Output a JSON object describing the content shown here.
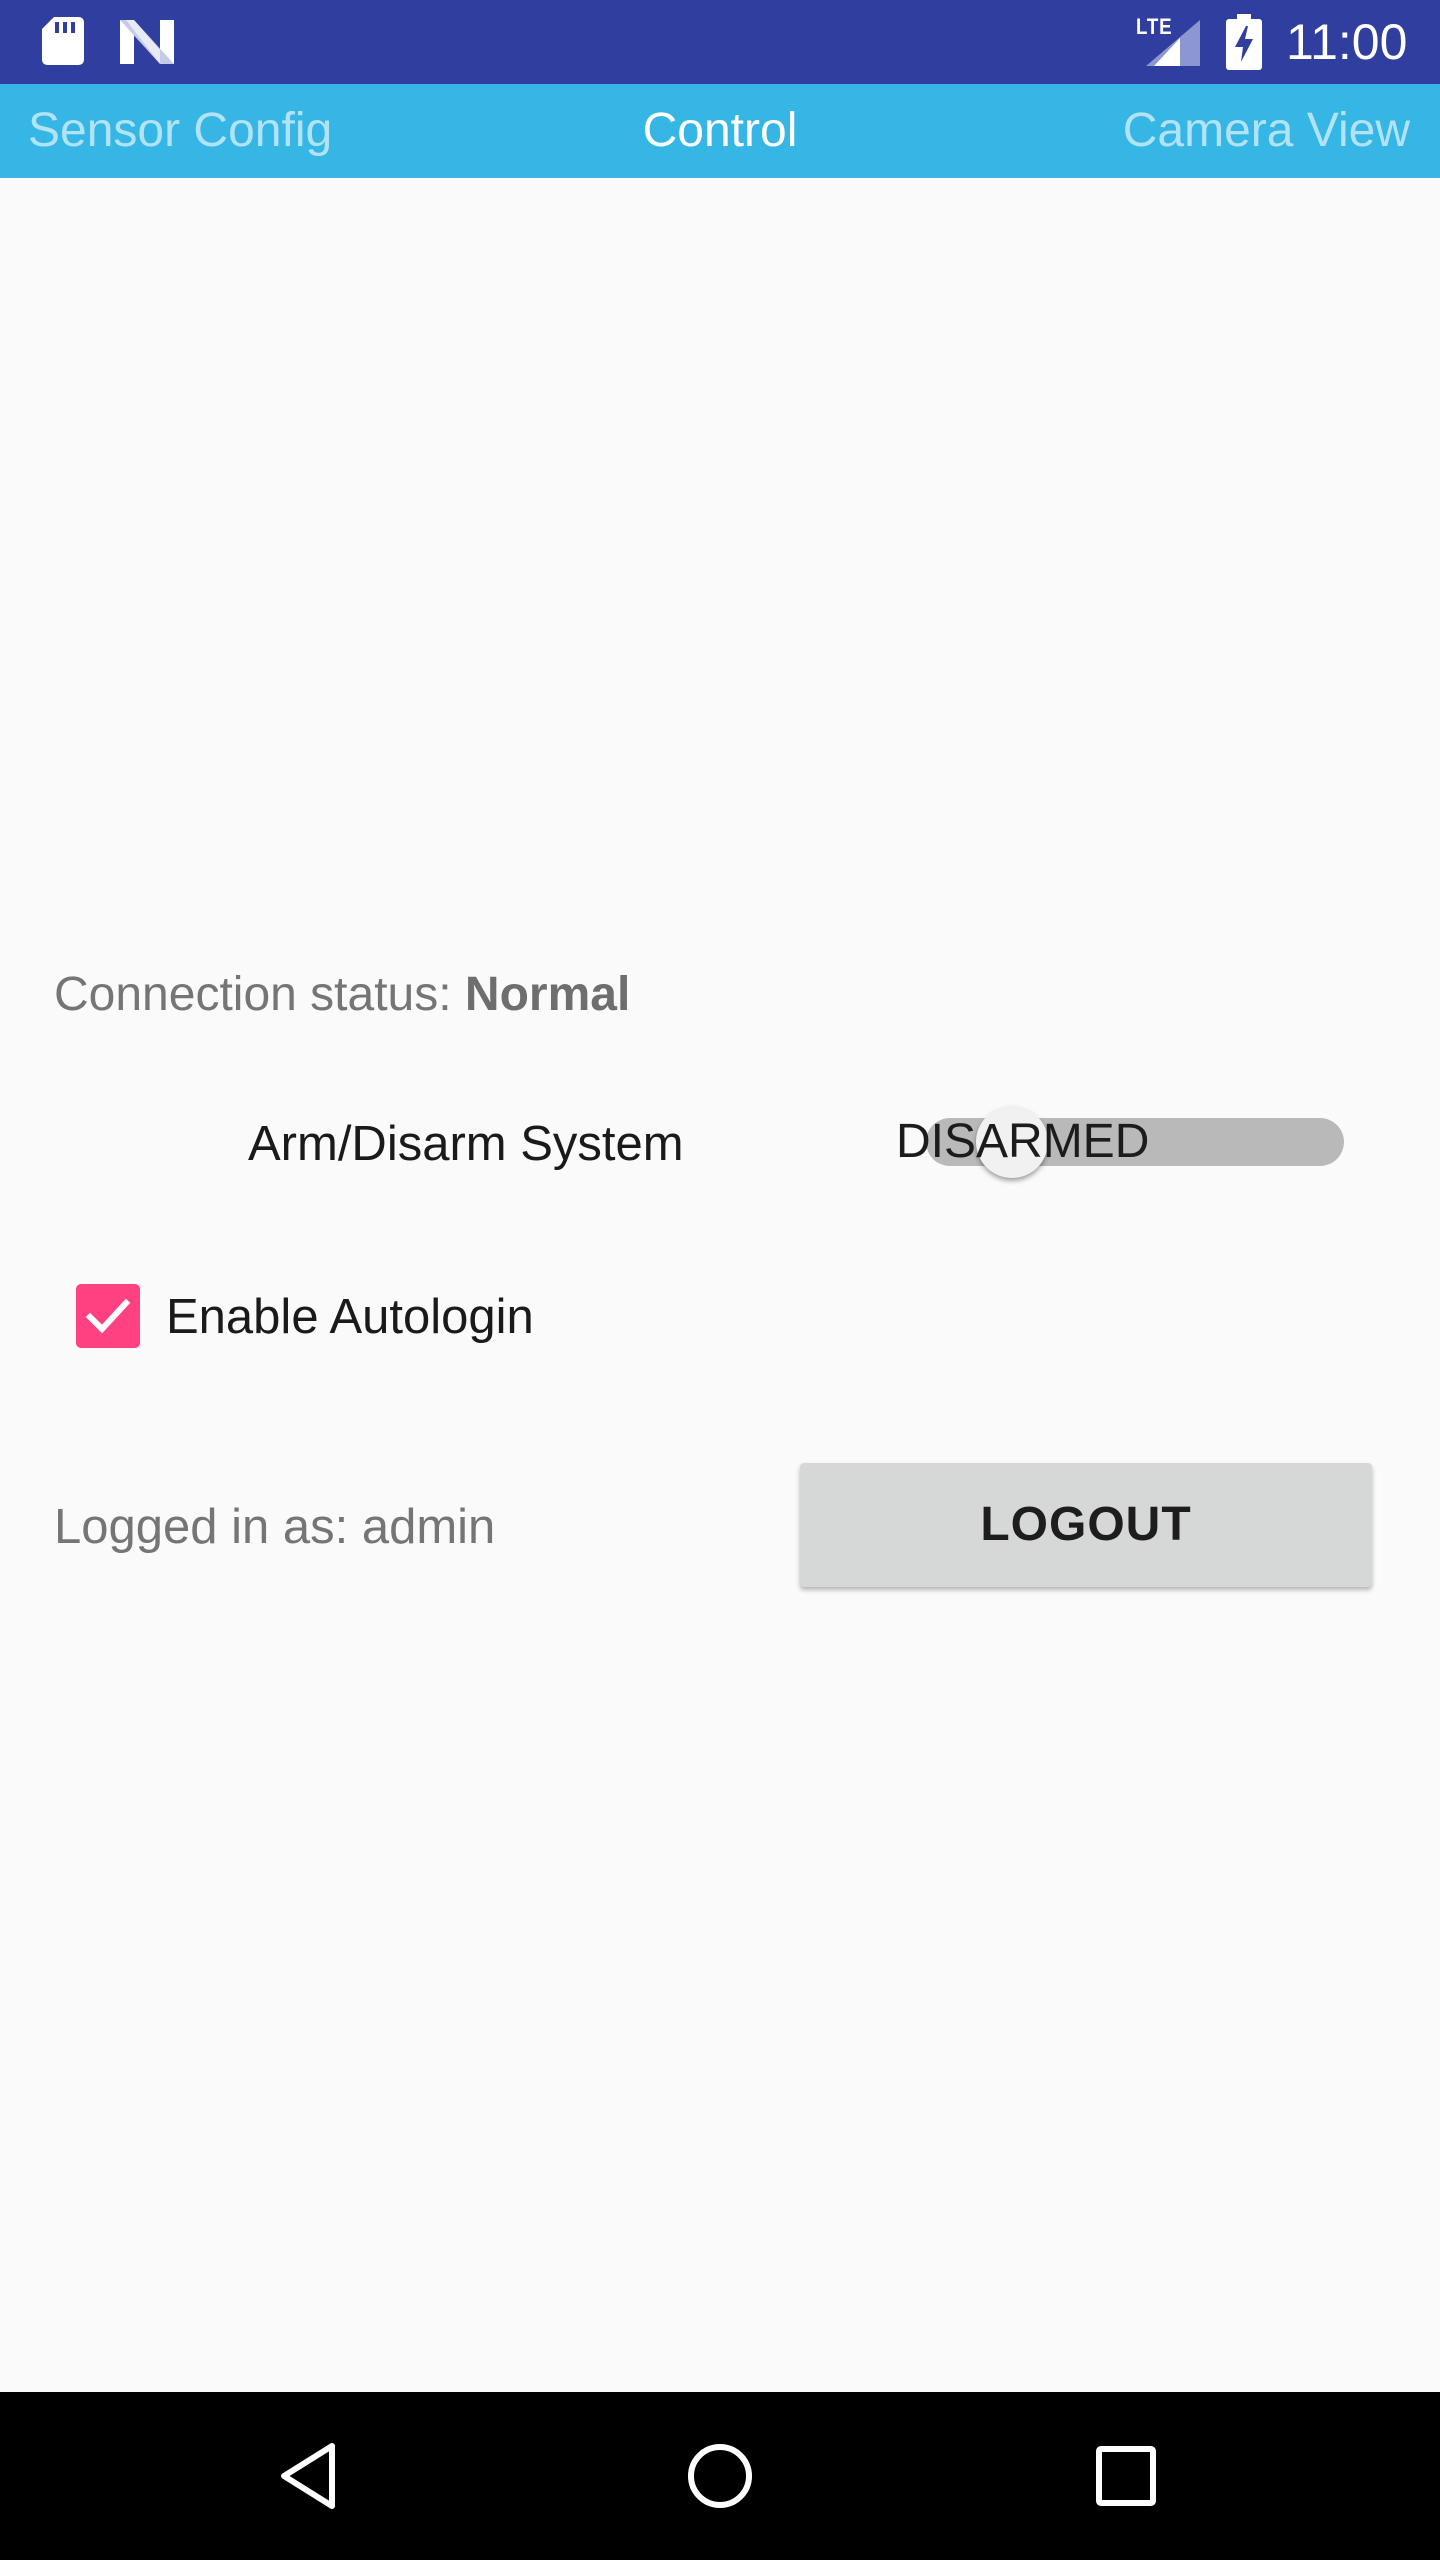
{
  "status_bar": {
    "network_label": "LTE",
    "time": "11:00",
    "icons": [
      "sd-card-icon",
      "n-icon",
      "lte-signal-icon",
      "battery-charging-icon"
    ],
    "background_color": "#303f9f"
  },
  "tabs": {
    "items": [
      {
        "label": "Sensor Config",
        "active": false
      },
      {
        "label": "Control",
        "active": true
      },
      {
        "label": "Camera View",
        "active": false
      }
    ],
    "background_color": "#35b6e5"
  },
  "control": {
    "connection_status_label": "Connection status: ",
    "connection_status_value": "Normal",
    "arm_label": "Arm/Disarm System",
    "arm_switch_state": "DISARMED",
    "arm_switch_on": false,
    "autologin_label": "Enable Autologin",
    "autologin_checked": true,
    "logged_in_text": "Logged in as: admin",
    "logout_label": "LOGOUT",
    "accent_color": "#ff4081"
  },
  "nav_bar": {
    "buttons": [
      "back-icon",
      "home-icon",
      "recents-icon"
    ]
  }
}
